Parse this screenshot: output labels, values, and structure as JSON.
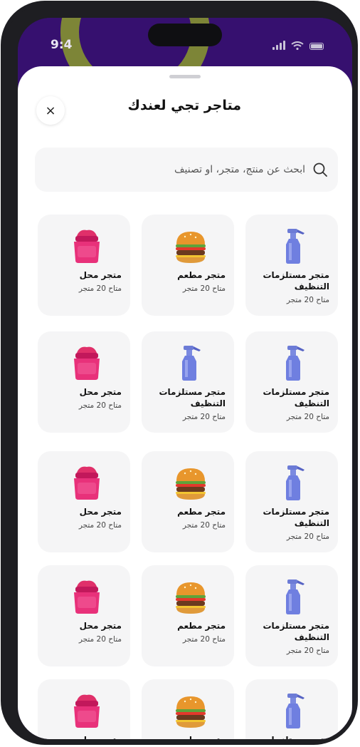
{
  "status_bar": {
    "time": "9:4"
  },
  "sheet": {
    "title": "متاجر تجي لعندك",
    "close_label": "×",
    "search": {
      "placeholder": "ابحث عن منتج، متجر، او تصنيف"
    }
  },
  "stores": [
    {
      "type": "cleaning",
      "name": "متجر مستلزمات التنظيف",
      "count": "متاح 20 متجر"
    },
    {
      "type": "restaurant",
      "name": "متجر مطعم",
      "count": "متاح 20 متجر"
    },
    {
      "type": "shop",
      "name": "متجر محل",
      "count": "متاح 20 متجر"
    },
    {
      "type": "cleaning",
      "name": "متجر مستلزمات التنظيف",
      "count": "متاح 20 متجر"
    },
    {
      "type": "cleaning",
      "name": "متجر مستلزمات التنظيف",
      "count": "متاح 20 متجر"
    },
    {
      "type": "shop",
      "name": "متجر محل",
      "count": "متاح 20 متجر"
    },
    {
      "type": "cleaning",
      "name": "متجر مستلزمات التنظيف",
      "count": "متاح 20 متجر"
    },
    {
      "type": "restaurant",
      "name": "متجر مطعم",
      "count": "متاح 20 متجر"
    },
    {
      "type": "shop",
      "name": "متجر محل",
      "count": "متاح 20 متجر"
    },
    {
      "type": "cleaning",
      "name": "متجر مستلزمات التنظيف",
      "count": "متاح 20 متجر"
    },
    {
      "type": "restaurant",
      "name": "متجر مطعم",
      "count": "متاح 20 متجر"
    },
    {
      "type": "shop",
      "name": "متجر محل",
      "count": "متاح 20 متجر"
    },
    {
      "type": "cleaning",
      "name": "متجر مستلزمات التنظيف",
      "count": ""
    },
    {
      "type": "restaurant",
      "name": "متجر مطعم",
      "count": ""
    },
    {
      "type": "shop",
      "name": "متجر محل",
      "count": ""
    }
  ],
  "icons": {
    "close": "close-icon",
    "search": "search-icon",
    "cleaning": "spray-bottle-icon",
    "restaurant": "burger-icon",
    "shop": "cosmetics-jar-icon"
  },
  "colors": {
    "header_bg": "#36106f",
    "accent_swirl": "#8a9a2e",
    "card_bg": "#f5f5f6"
  }
}
